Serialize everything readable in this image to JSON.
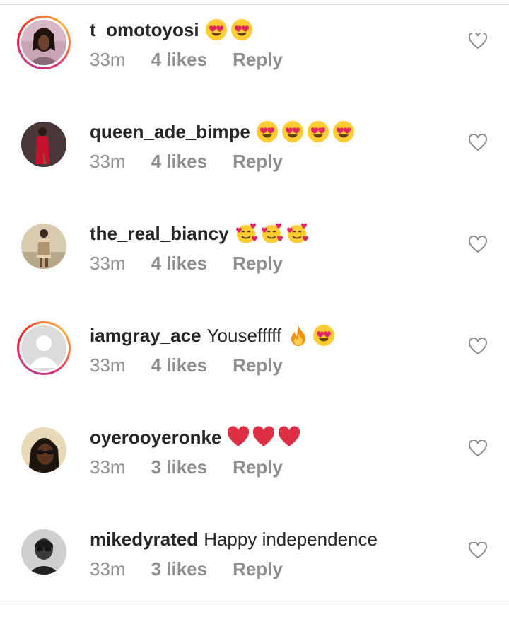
{
  "comments": [
    {
      "username": "t_omotoyosi",
      "text": "",
      "emojis": [
        "heart-eyes",
        "heart-eyes"
      ],
      "time": "33m",
      "likes": "4 likes",
      "reply": "Reply",
      "story_ring": true
    },
    {
      "username": "queen_ade_bimpe",
      "text": "",
      "emojis": [
        "heart-eyes",
        "heart-eyes",
        "heart-eyes",
        "heart-eyes"
      ],
      "time": "33m",
      "likes": "4 likes",
      "reply": "Reply",
      "story_ring": false
    },
    {
      "username": "the_real_biancy",
      "text": "",
      "emojis": [
        "smiling-hearts",
        "smiling-hearts",
        "smiling-hearts"
      ],
      "time": "33m",
      "likes": "4 likes",
      "reply": "Reply",
      "story_ring": false
    },
    {
      "username": "iamgray_ace",
      "text": "Yousefffff",
      "emojis": [
        "fire",
        "heart-eyes"
      ],
      "time": "33m",
      "likes": "4 likes",
      "reply": "Reply",
      "story_ring": true
    },
    {
      "username": "oyerooyeronke",
      "text": "",
      "emojis": [
        "red-heart",
        "red-heart",
        "red-heart"
      ],
      "time": "33m",
      "likes": "3 likes",
      "reply": "Reply",
      "story_ring": false
    },
    {
      "username": "mikedyrated",
      "text": "Happy independence",
      "emojis": [],
      "time": "33m",
      "likes": "3 likes",
      "reply": "Reply",
      "story_ring": false
    }
  ],
  "colors": {
    "username": "#262626",
    "meta": "#8e8e8e",
    "divider": "#dbdbdb",
    "heart_outline": "#8e8e8e"
  }
}
